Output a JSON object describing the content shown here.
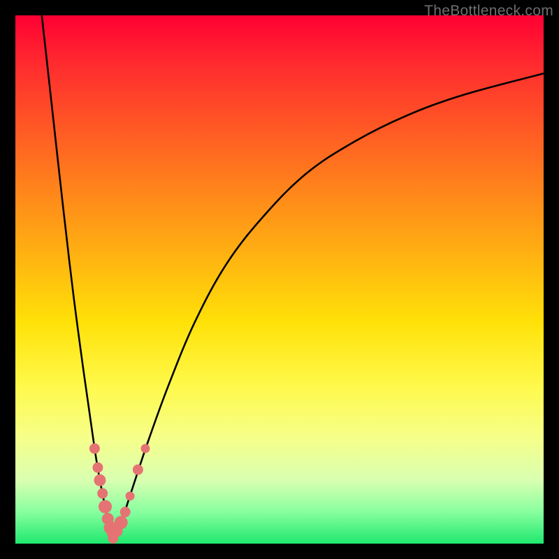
{
  "watermark": "TheBottleneck.com",
  "chart_data": {
    "type": "line",
    "title": "",
    "xlabel": "",
    "ylabel": "",
    "xlim": [
      0,
      100
    ],
    "ylim": [
      0,
      100
    ],
    "grid": false,
    "legend": false,
    "series": [
      {
        "name": "left-branch",
        "x": [
          5,
          7,
          9,
          11,
          13,
          15,
          16,
          17,
          18,
          18.5
        ],
        "y": [
          100,
          82,
          64,
          47,
          32,
          18,
          12,
          7,
          3,
          1
        ]
      },
      {
        "name": "right-branch",
        "x": [
          18.5,
          20,
          22,
          25,
          29,
          34,
          40,
          47,
          55,
          64,
          74,
          85,
          100
        ],
        "y": [
          1,
          4,
          10,
          19,
          30,
          42,
          53,
          62,
          70,
          76,
          81,
          85,
          89
        ]
      }
    ],
    "markers": [
      {
        "series": "left-branch",
        "x": 15.0,
        "y": 18.0,
        "r": 7
      },
      {
        "series": "left-branch",
        "x": 15.6,
        "y": 14.4,
        "r": 7
      },
      {
        "series": "left-branch",
        "x": 16.0,
        "y": 12.0,
        "r": 8
      },
      {
        "series": "left-branch",
        "x": 16.5,
        "y": 9.5,
        "r": 7
      },
      {
        "series": "left-branch",
        "x": 17.0,
        "y": 7.0,
        "r": 9
      },
      {
        "series": "left-branch",
        "x": 17.5,
        "y": 4.7,
        "r": 8
      },
      {
        "series": "left-branch",
        "x": 18.0,
        "y": 3.0,
        "r": 9
      },
      {
        "series": "left-branch",
        "x": 18.3,
        "y": 2.0,
        "r": 7
      },
      {
        "series": "right-branch",
        "x": 18.5,
        "y": 1.0,
        "r": 7
      },
      {
        "series": "right-branch",
        "x": 19.2,
        "y": 2.4,
        "r": 8
      },
      {
        "series": "right-branch",
        "x": 20.0,
        "y": 4.0,
        "r": 9
      },
      {
        "series": "right-branch",
        "x": 20.8,
        "y": 6.0,
        "r": 7
      },
      {
        "series": "right-branch",
        "x": 21.7,
        "y": 9.0,
        "r": 6
      },
      {
        "series": "right-branch",
        "x": 23.2,
        "y": 14.0,
        "r": 7
      },
      {
        "series": "right-branch",
        "x": 24.6,
        "y": 18.0,
        "r": 6
      }
    ],
    "colors": {
      "curve": "#000000",
      "marker_fill": "#e57373",
      "marker_stroke": "#e57373"
    }
  }
}
